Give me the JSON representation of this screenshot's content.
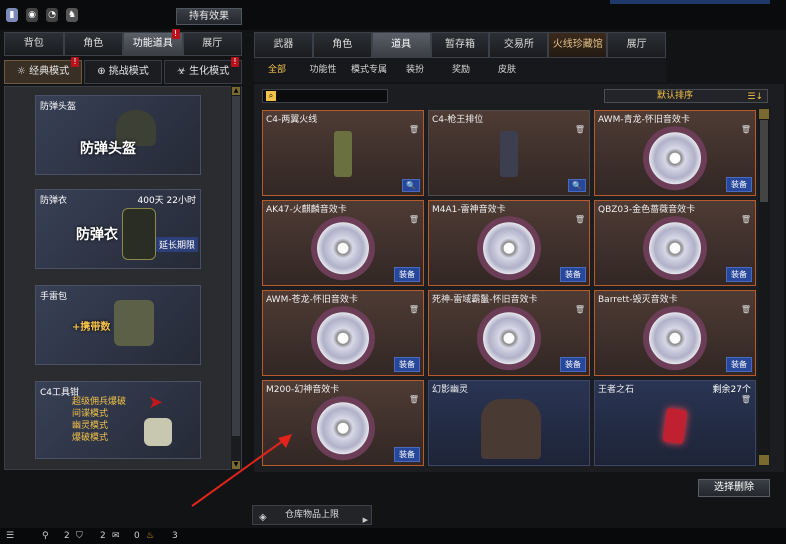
{
  "top": {
    "hold_effect": "持有效果"
  },
  "left_tabs": [
    {
      "label": "背包",
      "active": false
    },
    {
      "label": "角色",
      "active": false
    },
    {
      "label": "功能道具",
      "active": true
    },
    {
      "label": "展厅",
      "active": false
    }
  ],
  "modes": [
    {
      "label": "经典模式",
      "active": true
    },
    {
      "label": "挑战模式",
      "active": false
    },
    {
      "label": "生化模式",
      "active": false
    }
  ],
  "left_cards": [
    {
      "name": "防弹头盔",
      "big": "防弹头盔"
    },
    {
      "name": "防弹衣",
      "big": "防弹衣",
      "duration": "400天 22小时",
      "extend": "延长期限"
    },
    {
      "name": "手雷包",
      "big": "+携带数"
    },
    {
      "name": "C4工具钳",
      "lines": [
        "超级佣兵爆破",
        "间谍模式",
        "幽灵模式",
        "爆破模式"
      ]
    }
  ],
  "right_tabs": [
    {
      "label": "武器",
      "active": false
    },
    {
      "label": "角色",
      "active": false
    },
    {
      "label": "道具",
      "active": true
    },
    {
      "label": "暂存箱",
      "active": false
    },
    {
      "label": "交易所",
      "active": false
    },
    {
      "label": "火线珍藏馆",
      "active": false,
      "special": true
    },
    {
      "label": "展厅",
      "active": false
    }
  ],
  "sub_tabs": [
    {
      "label": "全部",
      "active": true
    },
    {
      "label": "功能性",
      "active": false
    },
    {
      "label": "模式专属",
      "active": false
    },
    {
      "label": "装扮",
      "active": false
    },
    {
      "label": "奖励",
      "active": false
    },
    {
      "label": "皮肤",
      "active": false
    }
  ],
  "sort": {
    "label": "默认排序"
  },
  "items": [
    {
      "name": "C4-两翼火线",
      "type": "bomb",
      "action": "mag"
    },
    {
      "name": "C4-枪王排位",
      "type": "bomb2",
      "action": "mag",
      "plain": true
    },
    {
      "name": "AWM-青龙-怀旧音效卡",
      "type": "disc",
      "action": "装备"
    },
    {
      "name": "AK47-火麒麟音效卡",
      "type": "disc",
      "action": "装备"
    },
    {
      "name": "M4A1-雷神音效卡",
      "type": "disc",
      "action": "装备"
    },
    {
      "name": "QBZ03-金色蔷薇音效卡",
      "type": "disc",
      "action": "装备"
    },
    {
      "name": "AWM-苍龙-怀旧音效卡",
      "type": "disc",
      "action": "装备"
    },
    {
      "name": "死神-雷域霸鬣-怀旧音效卡",
      "type": "disc",
      "action": "装备"
    },
    {
      "name": "Barrett-毁灭音效卡",
      "type": "disc",
      "action": "装备"
    },
    {
      "name": "M200-幻神音效卡",
      "type": "disc",
      "action": "装备"
    },
    {
      "name": "幻影幽灵",
      "type": "ghost",
      "action": "",
      "blue": true
    },
    {
      "name": "王者之石",
      "type": "gem",
      "action": "",
      "blue": true,
      "remain": "剩余27个"
    }
  ],
  "select_delete": "选择删除",
  "warehouse": "仓库物品上限",
  "bottom": {
    "count1": "2",
    "count2": "2",
    "count3": "0",
    "count4": "3"
  }
}
